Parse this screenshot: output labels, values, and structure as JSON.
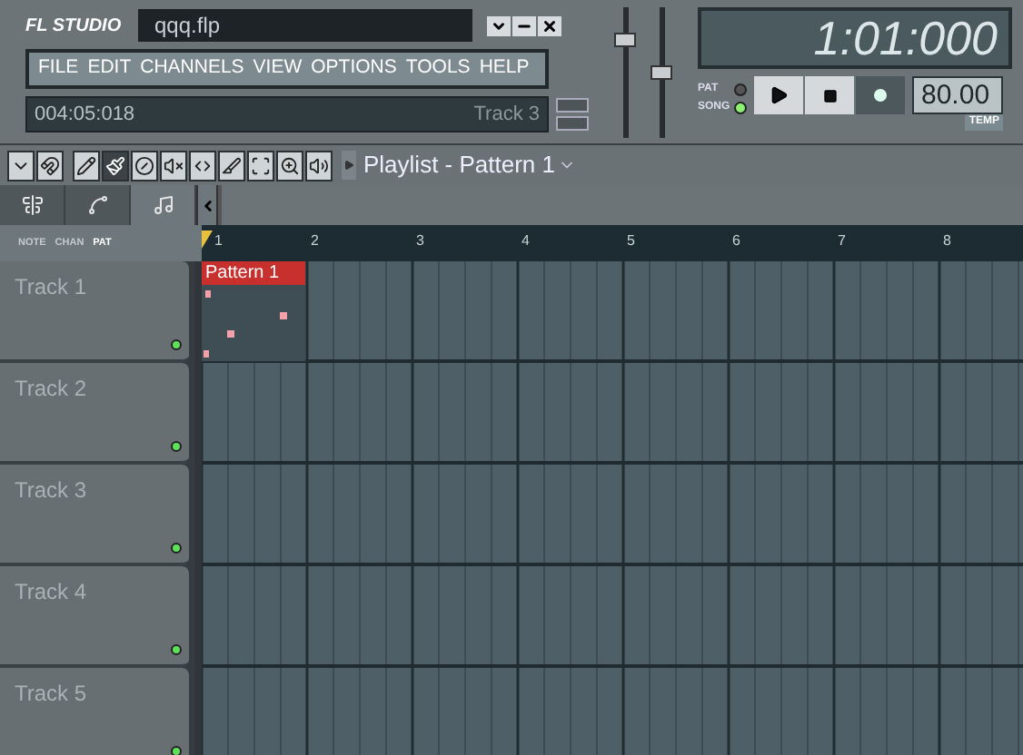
{
  "app": {
    "logo": "FL STUDIO",
    "filename": "qqq.flp"
  },
  "menu": [
    "FILE",
    "EDIT",
    "CHANNELS",
    "VIEW",
    "OPTIONS",
    "TOOLS",
    "HELP"
  ],
  "status": {
    "time": "004:05:018",
    "hint": "Track 3"
  },
  "display": {
    "time": "1:01:000"
  },
  "transport": {
    "modes": [
      {
        "label": "PAT",
        "selected": false
      },
      {
        "label": "SONG",
        "selected": true
      }
    ]
  },
  "tempo": {
    "value": "80.00",
    "label": "TEMP"
  },
  "tools": [
    {
      "selected": false
    },
    {
      "selected": false
    },
    {
      "selected": false
    },
    {
      "selected": true
    },
    {
      "selected": false
    },
    {
      "selected": false
    },
    {
      "selected": false
    },
    {
      "selected": false
    },
    {
      "selected": false
    },
    {
      "selected": false
    },
    {
      "selected": false
    }
  ],
  "playlist": {
    "title": "Playlist - Pattern 1",
    "side_tabs": [
      {
        "selected": false
      },
      {
        "selected": false
      },
      {
        "selected": true
      }
    ],
    "filters": [
      {
        "label": "NOTE",
        "selected": false
      },
      {
        "label": "CHAN",
        "selected": false
      },
      {
        "label": "PAT",
        "selected": true
      }
    ],
    "bars": [
      "1",
      "2",
      "3",
      "4",
      "5",
      "6",
      "7",
      "8"
    ],
    "clip": {
      "label": "Pattern 1"
    },
    "tracks": [
      {
        "name": "Track 1",
        "on": true
      },
      {
        "name": "Track 2",
        "on": true
      },
      {
        "name": "Track 3",
        "on": true
      },
      {
        "name": "Track 4",
        "on": true
      },
      {
        "name": "Track 5",
        "on": true
      }
    ]
  }
}
